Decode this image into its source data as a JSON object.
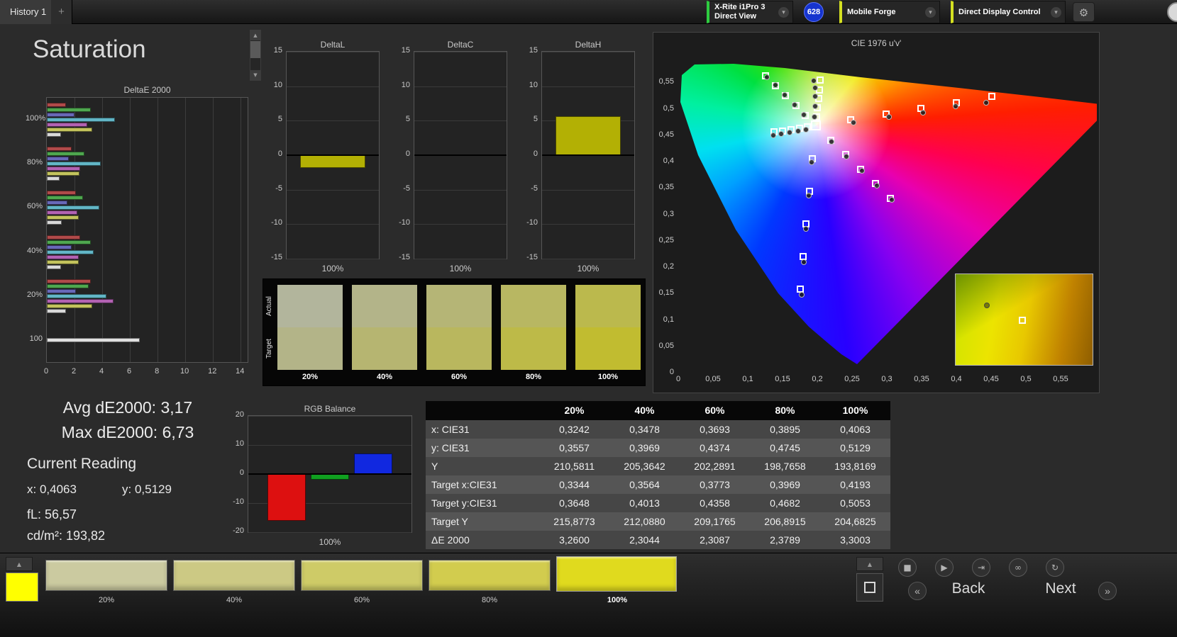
{
  "top_bar": {
    "history_tab": "History 1",
    "add_tab_label": "+",
    "meter_device": {
      "line1": "X-Rite i1Pro 3",
      "line2": "Direct View",
      "stripe_color": "#2ecc40"
    },
    "badge_count": "628",
    "source": {
      "label": "Mobile Forge",
      "stripe_color": "#d4e021"
    },
    "display_control": {
      "label": "Direct Display Control",
      "stripe_color": "#d4e021"
    }
  },
  "page_title": "Saturation",
  "icons": {
    "gear": "⚙",
    "chevron_down": "▾",
    "scroll_up": "▲",
    "scroll_down": "▼",
    "panel_up": "▲",
    "stop": "■",
    "play": "▶",
    "step": "⇥",
    "loop": "∞",
    "refresh": "↻",
    "first": "«",
    "last": "»"
  },
  "readings": {
    "avg": "Avg dE2000: 3,17",
    "max": "Max dE2000: 6,73",
    "current_title": "Current Reading",
    "x": "x: 0,4063",
    "y": "y: 0,5129",
    "fl": "fL: 56,57",
    "cdm2": "cd/m²: 193,82"
  },
  "swatch_strip": {
    "row_labels": [
      "Actual",
      "Target"
    ],
    "levels": [
      {
        "label": "20%",
        "actual": "#b2b59c",
        "target": "#b3b488"
      },
      {
        "label": "40%",
        "actual": "#b3b489",
        "target": "#b6b571"
      },
      {
        "label": "60%",
        "actual": "#b5b576",
        "target": "#b9b75e"
      },
      {
        "label": "80%",
        "actual": "#b8b762",
        "target": "#bdba48"
      },
      {
        "label": "100%",
        "actual": "#bbb94d",
        "target": "#c1bc30"
      }
    ]
  },
  "table": {
    "headers": [
      "",
      "20%",
      "40%",
      "60%",
      "80%",
      "100%"
    ],
    "rows": [
      {
        "label": "x: CIE31",
        "values": [
          "0,3242",
          "0,3478",
          "0,3693",
          "0,3895",
          "0,4063"
        ]
      },
      {
        "label": "y: CIE31",
        "values": [
          "0,3557",
          "0,3969",
          "0,4374",
          "0,4745",
          "0,5129"
        ]
      },
      {
        "label": "Y",
        "values": [
          "210,5811",
          "205,3642",
          "202,2891",
          "198,7658",
          "193,8169"
        ]
      },
      {
        "label": "Target x:CIE31",
        "values": [
          "0,3344",
          "0,3564",
          "0,3773",
          "0,3969",
          "0,4193"
        ]
      },
      {
        "label": "Target y:CIE31",
        "values": [
          "0,3648",
          "0,4013",
          "0,4358",
          "0,4682",
          "0,5053"
        ]
      },
      {
        "label": "Target Y",
        "values": [
          "215,8773",
          "212,0880",
          "209,1765",
          "206,8915",
          "204,6825"
        ]
      },
      {
        "label": "ΔE 2000",
        "values": [
          "3,2600",
          "2,3044",
          "2,3087",
          "2,3789",
          "3,3003"
        ]
      }
    ]
  },
  "bottom_bar": {
    "current_color": "#ffff00",
    "patches": [
      {
        "label": "20%",
        "color": "#cbcaa0"
      },
      {
        "label": "40%",
        "color": "#ccc984"
      },
      {
        "label": "60%",
        "color": "#cecb67"
      },
      {
        "label": "80%",
        "color": "#d2cc4e"
      },
      {
        "label": "100%",
        "color": "#e0da1e",
        "selected": true
      }
    ],
    "transport_icons": [
      "stop",
      "play",
      "step",
      "loop",
      "refresh"
    ],
    "back_label": "Back",
    "next_label": "Next"
  },
  "chart_data": {
    "deltae": {
      "type": "bar",
      "orientation": "horizontal",
      "title": "DeltaE 2000",
      "x_ticks": [
        "0",
        "2",
        "4",
        "6",
        "8",
        "10",
        "12",
        "14"
      ],
      "xmax": 14.5,
      "colors": [
        "#b04a4a",
        "#4fa74f",
        "#6868b8",
        "#62b6c6",
        "#b262b2",
        "#c3c35d",
        "#d9d9d9"
      ],
      "single_color": "#e0e0e0",
      "groups": [
        {
          "label": "100%",
          "values": [
            1.4,
            3.2,
            2.0,
            4.9,
            2.9,
            3.3,
            1.0
          ]
        },
        {
          "label": "80%",
          "values": [
            1.8,
            2.7,
            1.6,
            3.9,
            2.4,
            2.38,
            0.9
          ]
        },
        {
          "label": "60%",
          "values": [
            2.1,
            2.6,
            1.5,
            3.8,
            2.2,
            2.31,
            1.1
          ]
        },
        {
          "label": "40%",
          "values": [
            2.4,
            3.2,
            1.8,
            3.4,
            2.3,
            2.3,
            1.0
          ]
        },
        {
          "label": "20%",
          "values": [
            3.2,
            3.0,
            2.1,
            4.3,
            4.8,
            3.26,
            1.4
          ]
        },
        {
          "label": "100",
          "values": [
            6.73
          ]
        }
      ]
    },
    "deltaL": {
      "type": "bar",
      "title": "DeltaL",
      "x_label": "100%",
      "ylim": [
        -15,
        15
      ],
      "y_ticks": [
        "15",
        "10",
        "5",
        "0",
        "-5",
        "-10",
        "-15"
      ],
      "bars": [
        {
          "value": -1.8,
          "color": "#b3b004"
        }
      ]
    },
    "deltaC": {
      "type": "bar",
      "title": "DeltaC",
      "x_label": "100%",
      "ylim": [
        -15,
        15
      ],
      "y_ticks": [
        "15",
        "10",
        "5",
        "0",
        "-5",
        "-10",
        "-15"
      ],
      "bars": [
        {
          "value": 0.0,
          "color": "#b3b004"
        }
      ]
    },
    "deltaH": {
      "type": "bar",
      "title": "DeltaH",
      "x_label": "100%",
      "ylim": [
        -15,
        15
      ],
      "y_ticks": [
        "15",
        "10",
        "5",
        "0",
        "-5",
        "-10",
        "-15"
      ],
      "bars": [
        {
          "value": 5.6,
          "color": "#b3b004"
        }
      ]
    },
    "rgb": {
      "type": "bar",
      "title": "RGB Balance",
      "x_label": "100%",
      "ylim": [
        -20,
        20
      ],
      "y_ticks": [
        "20",
        "10",
        "0",
        "-10",
        "-20"
      ],
      "bars": [
        {
          "value": -16,
          "color": "#dd1010"
        },
        {
          "value": -2,
          "color": "#10a020"
        },
        {
          "value": 7,
          "color": "#1128e0"
        }
      ]
    },
    "cie": {
      "type": "scatter",
      "title": "CIE 1976 u'v'",
      "x_ticks": [
        "0",
        "0,05",
        "0,1",
        "0,15",
        "0,2",
        "0,25",
        "0,3",
        "0,35",
        "0,4",
        "0,45",
        "0,5",
        "0,55"
      ],
      "y_ticks": [
        "0",
        "0,05",
        "0,1",
        "0,15",
        "0,2",
        "0,25",
        "0,3",
        "0,35",
        "0,4",
        "0,45",
        "0,5",
        "0,55"
      ],
      "xlim": [
        0,
        0.602
      ],
      "ylim": [
        0,
        0.604
      ],
      "white_point": [
        0.198,
        0.468
      ],
      "targets": [
        [
          0.248,
          0.479
        ],
        [
          0.299,
          0.49
        ],
        [
          0.349,
          0.501
        ],
        [
          0.4,
          0.512
        ],
        [
          0.451,
          0.523
        ],
        [
          0.183,
          0.487
        ],
        [
          0.169,
          0.506
        ],
        [
          0.154,
          0.525
        ],
        [
          0.14,
          0.544
        ],
        [
          0.125,
          0.562
        ],
        [
          0.193,
          0.406
        ],
        [
          0.189,
          0.344
        ],
        [
          0.184,
          0.282
        ],
        [
          0.18,
          0.22
        ],
        [
          0.175,
          0.158
        ],
        [
          0.186,
          0.466
        ],
        [
          0.174,
          0.463
        ],
        [
          0.162,
          0.461
        ],
        [
          0.15,
          0.458
        ],
        [
          0.138,
          0.456
        ],
        [
          0.219,
          0.44
        ],
        [
          0.241,
          0.413
        ],
        [
          0.262,
          0.385
        ],
        [
          0.284,
          0.358
        ],
        [
          0.305,
          0.33
        ],
        [
          0.199,
          0.485
        ],
        [
          0.2,
          0.502
        ],
        [
          0.202,
          0.519
        ],
        [
          0.203,
          0.536
        ],
        [
          0.204,
          0.554
        ]
      ],
      "measurements": [
        [
          0.252,
          0.474
        ],
        [
          0.303,
          0.484
        ],
        [
          0.352,
          0.493
        ],
        [
          0.399,
          0.505
        ],
        [
          0.443,
          0.512
        ],
        [
          0.181,
          0.489
        ],
        [
          0.167,
          0.508
        ],
        [
          0.153,
          0.526
        ],
        [
          0.14,
          0.545
        ],
        [
          0.128,
          0.56
        ],
        [
          0.192,
          0.398
        ],
        [
          0.188,
          0.335
        ],
        [
          0.184,
          0.272
        ],
        [
          0.181,
          0.21
        ],
        [
          0.178,
          0.148
        ],
        [
          0.184,
          0.461
        ],
        [
          0.172,
          0.458
        ],
        [
          0.16,
          0.455
        ],
        [
          0.148,
          0.452
        ],
        [
          0.137,
          0.449
        ],
        [
          0.22,
          0.437
        ],
        [
          0.242,
          0.41
        ],
        [
          0.264,
          0.382
        ],
        [
          0.286,
          0.354
        ],
        [
          0.307,
          0.327
        ],
        [
          0.196,
          0.484
        ],
        [
          0.197,
          0.505
        ],
        [
          0.197,
          0.524
        ],
        [
          0.197,
          0.54
        ],
        [
          0.195,
          0.553
        ]
      ],
      "inset_markers": {
        "circle": [
          44,
          44
        ],
        "square": [
          94,
          65
        ]
      }
    }
  }
}
